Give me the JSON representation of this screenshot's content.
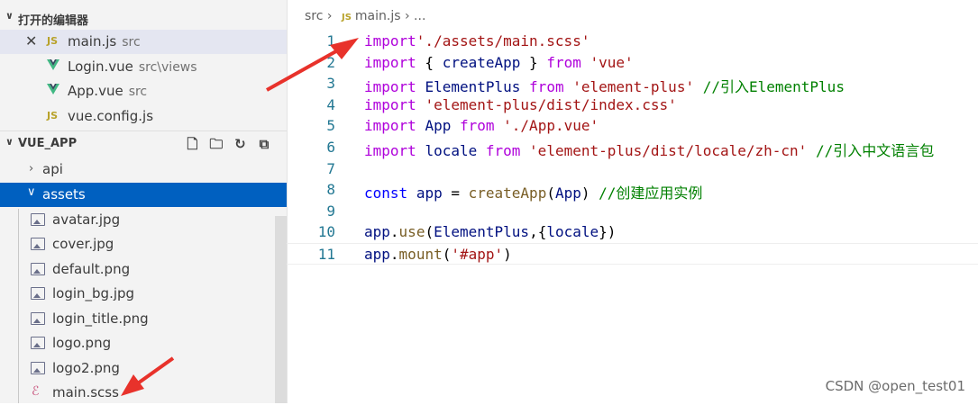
{
  "sidebar": {
    "open_editors_title": "打开的编辑器",
    "open_editors": [
      {
        "name": "main.js",
        "desc": "src",
        "icon": "js-icon"
      },
      {
        "name": "Login.vue",
        "desc": "src\\views",
        "icon": "vue-icon"
      },
      {
        "name": "App.vue",
        "desc": "src",
        "icon": "vue-icon"
      },
      {
        "name": "vue.config.js",
        "desc": "",
        "icon": "js-icon"
      }
    ],
    "project_title": "VUE_APP",
    "tree": [
      {
        "name": "api",
        "type": "folder",
        "expanded": false
      },
      {
        "name": "assets",
        "type": "folder",
        "expanded": true
      },
      {
        "name": "avatar.jpg",
        "type": "image"
      },
      {
        "name": "cover.jpg",
        "type": "image"
      },
      {
        "name": "default.png",
        "type": "image"
      },
      {
        "name": "login_bg.jpg",
        "type": "image"
      },
      {
        "name": "login_title.png",
        "type": "image"
      },
      {
        "name": "logo.png",
        "type": "image"
      },
      {
        "name": "logo2.png",
        "type": "image"
      },
      {
        "name": "main.scss",
        "type": "scss"
      }
    ]
  },
  "breadcrumb": {
    "folder": "src",
    "file": "main.js",
    "more": "..."
  },
  "code": {
    "line_numbers": [
      "1",
      "2",
      "3",
      "4",
      "5",
      "6",
      "7",
      "8",
      "9",
      "10",
      "11"
    ],
    "lines": [
      [
        [
          "kc",
          "import"
        ],
        [
          "s",
          "'./assets/main.scss'"
        ]
      ],
      [
        [
          "kc",
          "import"
        ],
        [
          "p",
          " { "
        ],
        [
          "v",
          "createApp"
        ],
        [
          "p",
          " } "
        ],
        [
          "kc",
          "from"
        ],
        [
          "p",
          " "
        ],
        [
          "s",
          "'vue'"
        ]
      ],
      [
        [
          "kc",
          "import"
        ],
        [
          "p",
          " "
        ],
        [
          "v",
          "ElementPlus"
        ],
        [
          "p",
          " "
        ],
        [
          "kc",
          "from"
        ],
        [
          "p",
          " "
        ],
        [
          "s",
          "'element-plus'"
        ],
        [
          "p",
          " "
        ],
        [
          "c",
          "//引入ElementPlus"
        ]
      ],
      [
        [
          "kc",
          "import"
        ],
        [
          "p",
          " "
        ],
        [
          "s",
          "'element-plus/dist/index.css'"
        ]
      ],
      [
        [
          "kc",
          "import"
        ],
        [
          "p",
          " "
        ],
        [
          "v",
          "App"
        ],
        [
          "p",
          " "
        ],
        [
          "kc",
          "from"
        ],
        [
          "p",
          " "
        ],
        [
          "s",
          "'./App.vue'"
        ]
      ],
      [
        [
          "kc",
          "import"
        ],
        [
          "p",
          " "
        ],
        [
          "v",
          "locale"
        ],
        [
          "p",
          " "
        ],
        [
          "kc",
          "from"
        ],
        [
          "p",
          " "
        ],
        [
          "s",
          "'element-plus/dist/locale/zh-cn'"
        ],
        [
          "p",
          " "
        ],
        [
          "c",
          "//引入中文语言包"
        ]
      ],
      [],
      [
        [
          "k",
          "const"
        ],
        [
          "p",
          " "
        ],
        [
          "v",
          "app"
        ],
        [
          "p",
          " = "
        ],
        [
          "f",
          "createApp"
        ],
        [
          "p",
          "("
        ],
        [
          "v",
          "App"
        ],
        [
          "p",
          ") "
        ],
        [
          "c",
          "//创建应用实例"
        ]
      ],
      [],
      [
        [
          "v",
          "app"
        ],
        [
          "p",
          "."
        ],
        [
          "f",
          "use"
        ],
        [
          "p",
          "("
        ],
        [
          "v",
          "ElementPlus"
        ],
        [
          "p",
          ",{"
        ],
        [
          "v",
          "locale"
        ],
        [
          "p",
          "})"
        ]
      ],
      [
        [
          "v",
          "app"
        ],
        [
          "p",
          "."
        ],
        [
          "f",
          "mount"
        ],
        [
          "p",
          "("
        ],
        [
          "s",
          "'#app'"
        ],
        [
          "p",
          ")"
        ]
      ]
    ]
  },
  "colors": {
    "accent": "#0060c0",
    "arrow": "#e8322b"
  },
  "watermark": "CSDN @open_test01"
}
